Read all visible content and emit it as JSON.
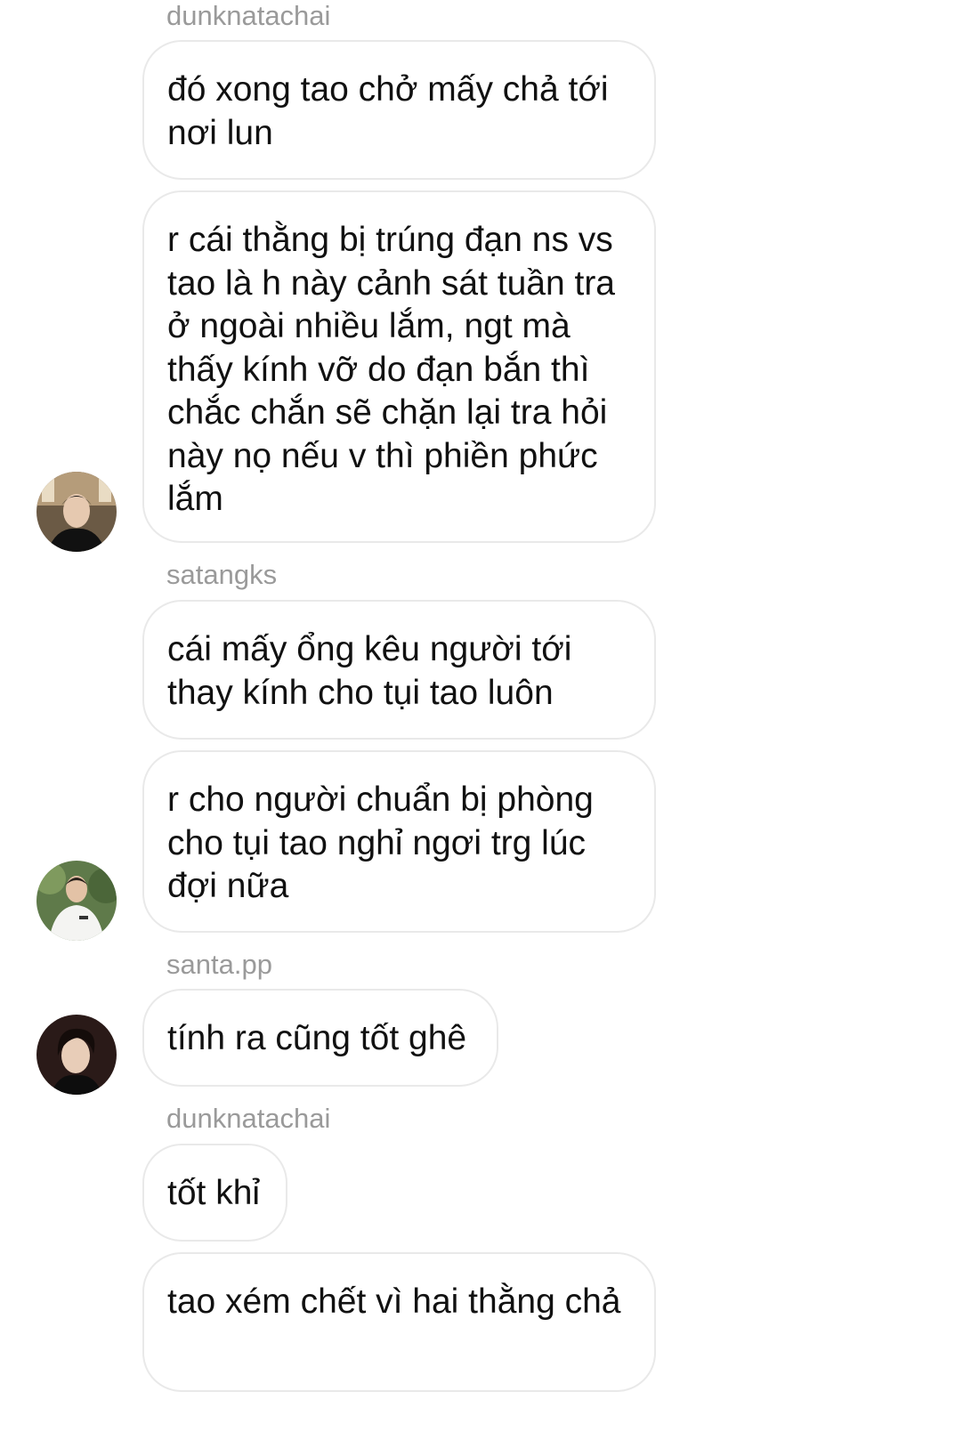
{
  "thread": [
    {
      "sender": "dunknatachai",
      "messages": [
        "đó xong tao chở mấy chả tới nơi lun",
        "r cái thằng bị trúng đạn ns vs tao là h này cảnh sát tuần tra ở ngoài nhiều lắm, ngt mà thấy kính vỡ do đạn bắn thì chắc chắn sẽ chặn lại tra hỏi này nọ nếu v thì phiền phức lắm"
      ],
      "avatar": "avatar-dunknatachai"
    },
    {
      "sender": "satangks",
      "messages": [
        "cái mấy ổng kêu người tới thay kính cho tụi tao luôn",
        "r cho người chuẩn bị phòng cho tụi tao nghỉ ngơi trg lúc đợi nữa"
      ],
      "avatar": "avatar-satangks"
    },
    {
      "sender": "santa.pp",
      "messages": [
        "tính ra cũng tốt ghê"
      ],
      "avatar": "avatar-santa"
    },
    {
      "sender": "dunknatachai",
      "messages": [
        "tốt khỉ",
        "tao xém chết vì hai thằng chả"
      ]
    }
  ],
  "colors": {
    "background": "#ffffff",
    "bubble_border": "#e9e9e9",
    "sender_text": "#9a9a9a",
    "message_text": "#111111"
  }
}
